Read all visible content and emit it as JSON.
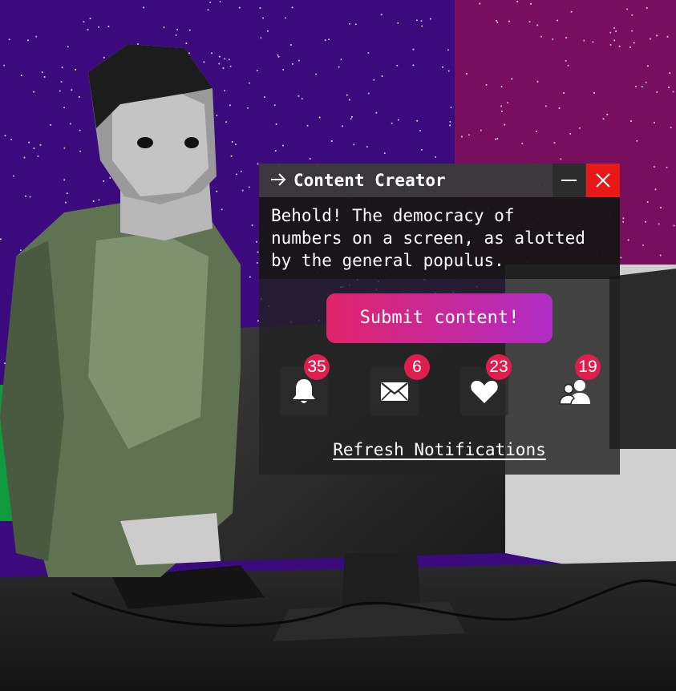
{
  "window": {
    "title": "Content Creator",
    "title_icon": "arrow-right-icon",
    "description": "Behold! The democracy of\nnumbers on a screen, as alotted\nby the general populus.",
    "submit_label": "Submit content!",
    "refresh_label": "Refresh Notifications",
    "controls": {
      "minimize_icon": "minimize-icon",
      "close_icon": "close-icon"
    }
  },
  "notifications": [
    {
      "name": "bell",
      "icon": "bell-icon",
      "count": "35"
    },
    {
      "name": "mail",
      "icon": "mail-icon",
      "count": "6"
    },
    {
      "name": "heart",
      "icon": "heart-icon",
      "count": "23"
    },
    {
      "name": "users",
      "icon": "users-icon",
      "count": "19"
    }
  ],
  "colors": {
    "close_button": "#e81818",
    "badge": "#e01e4e",
    "button_gradient_start": "#e0246a",
    "button_gradient_end": "#b02cc6",
    "background_purple": "#3a0a7a",
    "background_magenta": "#7a0e5c"
  }
}
